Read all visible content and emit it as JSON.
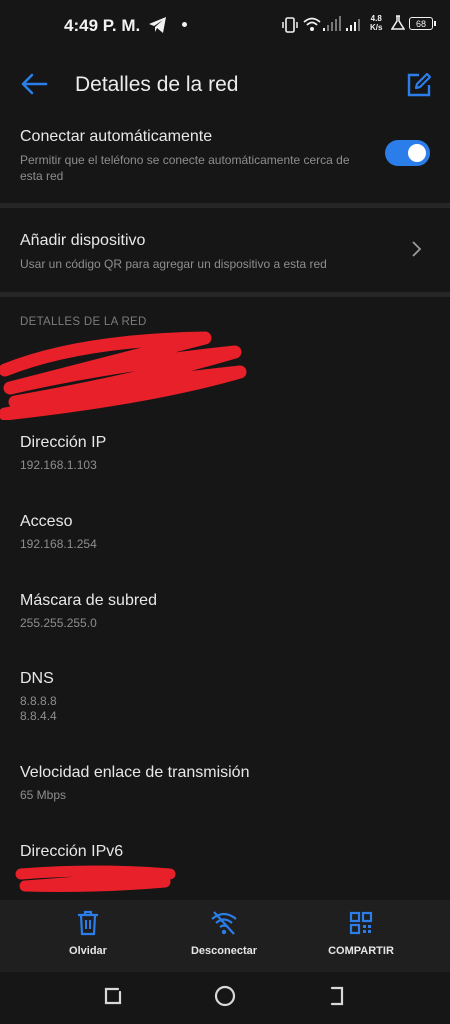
{
  "status_bar": {
    "time": "4:49 P. M.",
    "speed_value": "4.8",
    "speed_unit": "K/s",
    "battery": "68"
  },
  "header": {
    "title": "Detalles de la red"
  },
  "auto_connect": {
    "title": "Conectar automáticamente",
    "subtitle": "Permitir que el teléfono se conecte automáticamente cerca de esta red",
    "enabled": true
  },
  "add_device": {
    "title": "Añadir dispositivo",
    "subtitle": "Usar un código QR para agregar un dispositivo a esta red"
  },
  "section": {
    "title": "DETALLES DE LA RED"
  },
  "details": [
    {
      "label": "Dirección IP",
      "value": "192.168.1.103"
    },
    {
      "label": "Acceso",
      "value": "192.168.1.254"
    },
    {
      "label": "Máscara de subred",
      "value": "255.255.255.0"
    },
    {
      "label": "DNS",
      "value": "8.8.8.8",
      "value2": "8.8.4.4"
    },
    {
      "label": "Velocidad enlace de transmisión",
      "value": "65 Mbps"
    },
    {
      "label": "Dirección IPv6",
      "value": ""
    }
  ],
  "actions": {
    "forget": "Olvidar",
    "disconnect": "Desconectar",
    "share": "COMPARTIR"
  },
  "colors": {
    "accent": "#2b7de9",
    "background": "#161616",
    "redaction": "#e8202a"
  }
}
